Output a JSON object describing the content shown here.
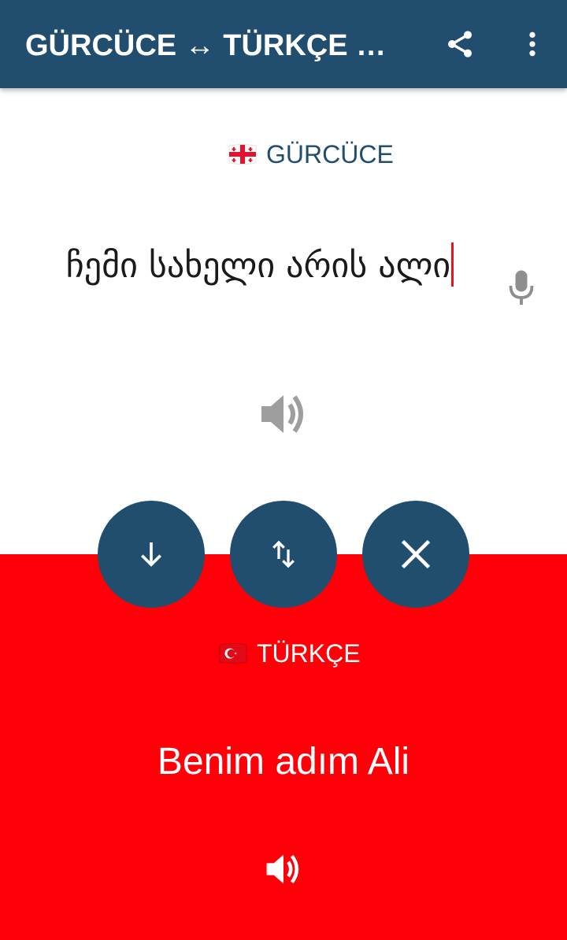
{
  "appbar": {
    "title": "GÜRCÜCE ↔ TÜRKÇE SESLİ ÇEVİRMEN",
    "share_icon": "share-icon",
    "more_icon": "more-vert-icon"
  },
  "colors": {
    "primary": "#214d6e",
    "accent": "#ff0009",
    "caret": "#e8131c"
  },
  "source": {
    "language": "GÜRCÜCE",
    "flag_icon": "georgia-flag-icon",
    "text": "ჩემი სახელი არის ალი",
    "mic_icon": "mic-icon",
    "speaker_icon": "speaker-icon"
  },
  "actions": {
    "down_icon": "arrow-down-icon",
    "swap_icon": "swap-vertical-icon",
    "clear_icon": "close-icon"
  },
  "target": {
    "language": "TÜRKÇE",
    "flag_icon": "turkey-flag-icon",
    "text": "Benim adım Ali",
    "speaker_icon": "speaker-icon"
  }
}
